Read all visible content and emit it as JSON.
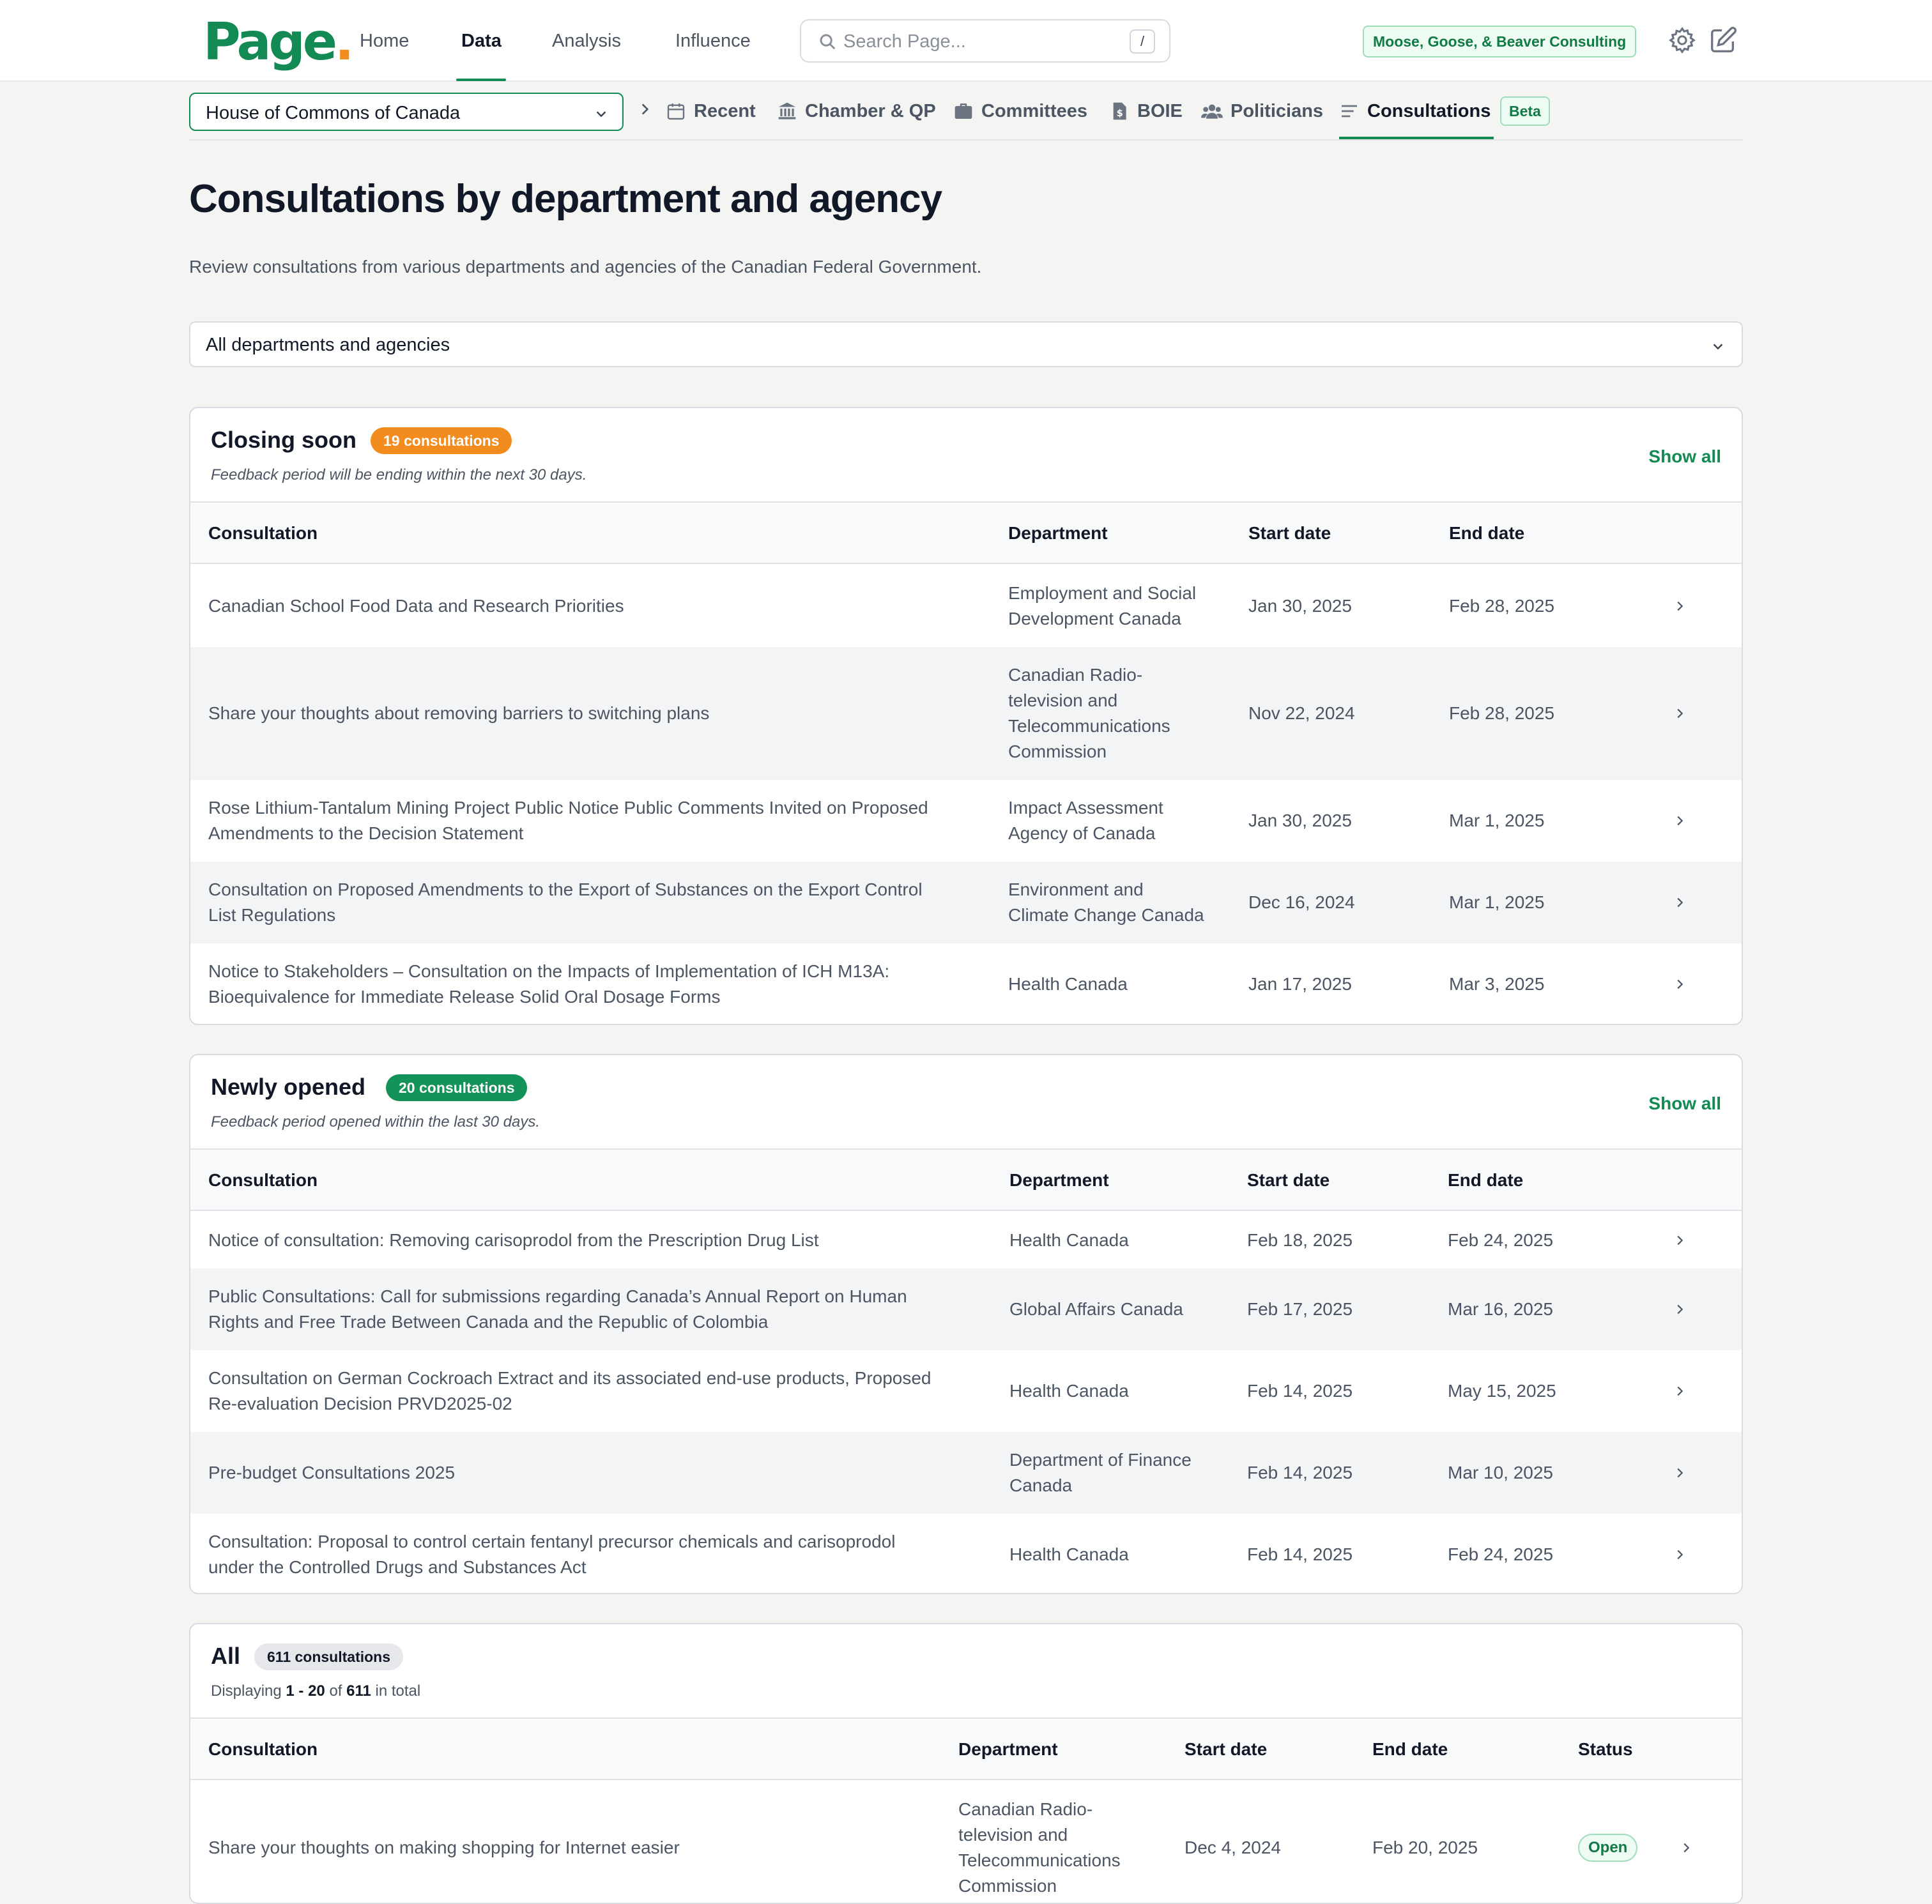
{
  "nav": {
    "logo": "Page",
    "logo_dot": ".",
    "links": [
      "Home",
      "Data",
      "Analysis",
      "Influence"
    ],
    "active": "Data",
    "search_placeholder": "Search Page...",
    "search_shortcut": "/",
    "org": "Moose, Goose, & Beaver Consulting"
  },
  "subnav": {
    "house": "House of Commons of Canada",
    "tabs": [
      "Recent",
      "Chamber & QP",
      "Committees",
      "BOIE",
      "Politicians",
      "Consultations"
    ],
    "active": "Consultations",
    "beta": "Beta"
  },
  "page": {
    "title": "Consultations by department and agency",
    "subtitle": "Review consultations from various departments and agencies of the Canadian Federal Government.",
    "dept_filter": "All departments and agencies"
  },
  "columns": {
    "consultation": "Consultation",
    "department": "Department",
    "start": "Start date",
    "end": "End date",
    "status": "Status"
  },
  "closing": {
    "title": "Closing soon",
    "count": "19 consultations",
    "note": "Feedback period will be ending within the next 30 days.",
    "show_all": "Show all",
    "rows": [
      {
        "title": [
          "Canadian School Food Data and Research Priorities"
        ],
        "dept": [
          "Employment and Social",
          "Development Canada"
        ],
        "start": "Jan 30, 2025",
        "end": "Feb 28, 2025"
      },
      {
        "title": [
          "Share your thoughts about removing barriers to switching plans"
        ],
        "dept": [
          "Canadian Radio-",
          "television and",
          "Telecommunications",
          "Commission"
        ],
        "start": "Nov 22, 2024",
        "end": "Feb 28, 2025"
      },
      {
        "title": [
          "Rose Lithium-Tantalum Mining Project Public Notice Public Comments Invited on Proposed",
          "Amendments to the Decision Statement"
        ],
        "dept": [
          "Impact Assessment",
          "Agency of Canada"
        ],
        "start": "Jan 30, 2025",
        "end": "Mar 1, 2025"
      },
      {
        "title": [
          "Consultation on Proposed Amendments to the Export of Substances on the Export Control",
          "List Regulations"
        ],
        "dept": [
          "Environment and",
          "Climate Change Canada"
        ],
        "start": "Dec 16, 2024",
        "end": "Mar 1, 2025"
      },
      {
        "title": [
          "Notice to Stakeholders – Consultation on the Impacts of Implementation of ICH M13A:",
          "Bioequivalence for Immediate Release Solid Oral Dosage Forms"
        ],
        "dept": [
          "Health Canada"
        ],
        "start": "Jan 17, 2025",
        "end": "Mar 3, 2025"
      }
    ]
  },
  "newly": {
    "title": "Newly opened",
    "count": "20 consultations",
    "note": "Feedback period opened within the last 30 days.",
    "show_all": "Show all",
    "rows": [
      {
        "title": [
          "Notice of consultation: Removing carisoprodol from the Prescription Drug List"
        ],
        "dept": [
          "Health Canada"
        ],
        "start": "Feb 18, 2025",
        "end": "Feb 24, 2025"
      },
      {
        "title": [
          "Public Consultations: Call for submissions regarding Canada’s Annual Report on Human",
          "Rights and Free Trade Between Canada and the Republic of Colombia"
        ],
        "dept": [
          "Global Affairs Canada"
        ],
        "start": "Feb 17, 2025",
        "end": "Mar 16, 2025"
      },
      {
        "title": [
          "Consultation on German Cockroach Extract and its associated end-use products, Proposed",
          "Re-evaluation Decision PRVD2025-02"
        ],
        "dept": [
          "Health Canada"
        ],
        "start": "Feb 14, 2025",
        "end": "May 15, 2025"
      },
      {
        "title": [
          "Pre-budget Consultations 2025"
        ],
        "dept": [
          "Department of Finance",
          "Canada"
        ],
        "start": "Feb 14, 2025",
        "end": "Mar 10, 2025"
      },
      {
        "title": [
          "Consultation: Proposal to control certain fentanyl precursor chemicals and carisoprodol",
          "under the Controlled Drugs and Substances Act"
        ],
        "dept": [
          "Health Canada"
        ],
        "start": "Feb 14, 2025",
        "end": "Feb 24, 2025"
      }
    ]
  },
  "all": {
    "title": "All",
    "count": "611 consultations",
    "display_prefix": "Displaying",
    "display_range": "1 - 20",
    "display_of": "of",
    "display_total": "611",
    "display_suffix": "in total",
    "rows": [
      {
        "title": [
          "Share your thoughts on making shopping for Internet easier"
        ],
        "dept": [
          "Canadian Radio-",
          "television and",
          "Telecommunications",
          "Commission"
        ],
        "start": "Dec 4, 2024",
        "end": "Feb 20, 2025",
        "status": "Open"
      }
    ]
  }
}
